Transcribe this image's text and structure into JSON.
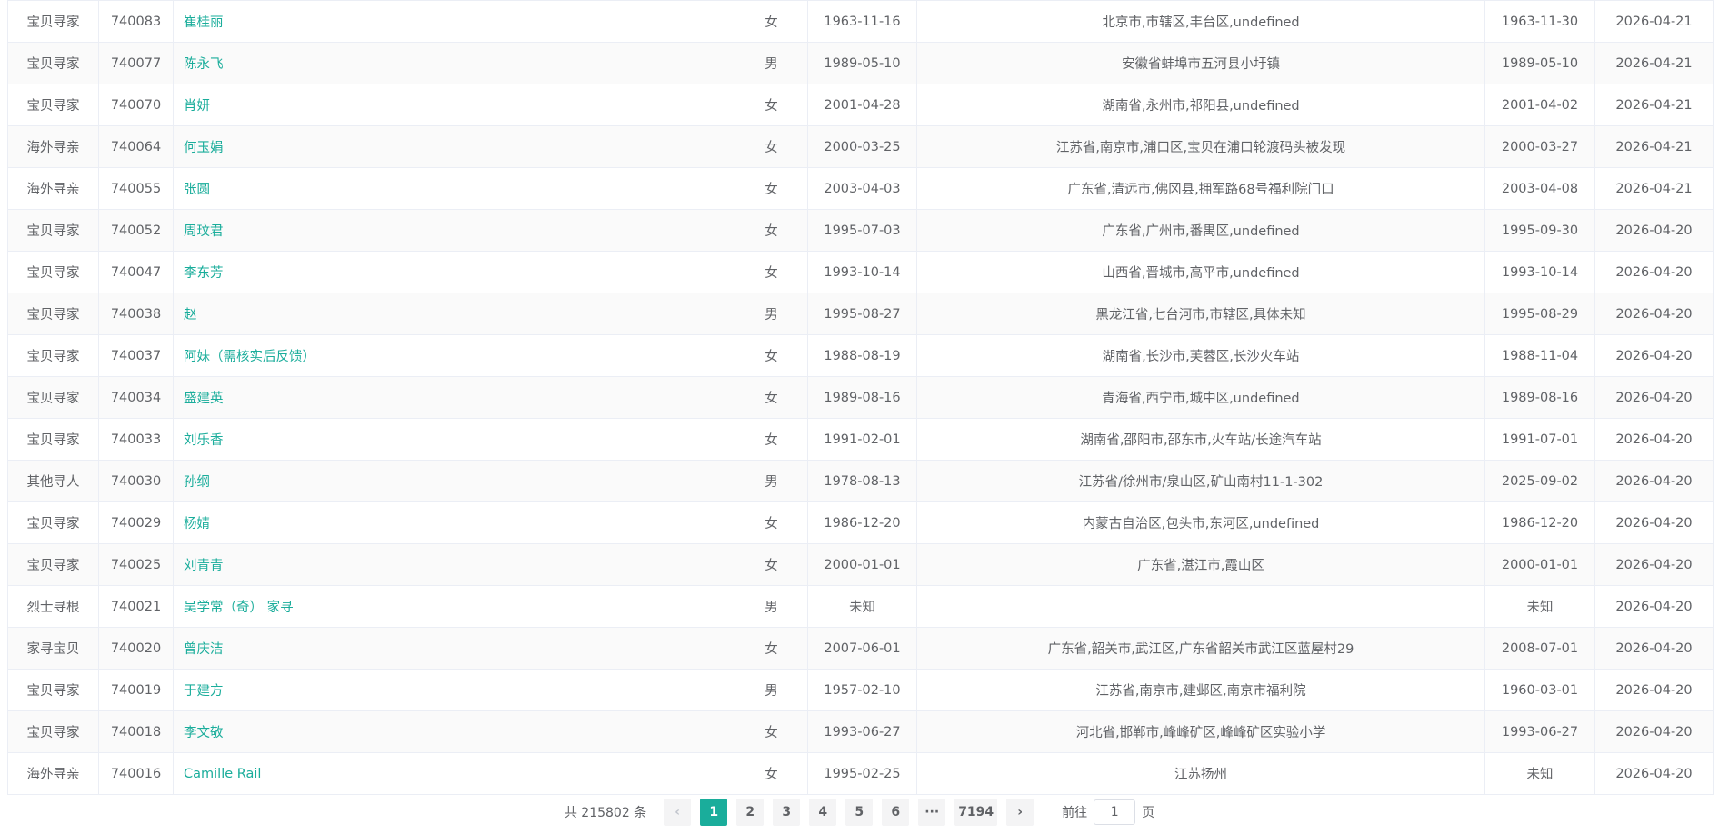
{
  "rows": [
    {
      "category": "宝贝寻家",
      "id": "740083",
      "name": "崔桂丽",
      "gender": "女",
      "birth": "1963-11-16",
      "place": "北京市,市辖区,丰台区,undefined",
      "lost": "1963-11-30",
      "posted": "2026-04-21"
    },
    {
      "category": "宝贝寻家",
      "id": "740077",
      "name": "陈永飞",
      "gender": "男",
      "birth": "1989-05-10",
      "place": "安徽省蚌埠市五河县小圩镇",
      "lost": "1989-05-10",
      "posted": "2026-04-21"
    },
    {
      "category": "宝贝寻家",
      "id": "740070",
      "name": "肖妍",
      "gender": "女",
      "birth": "2001-04-28",
      "place": "湖南省,永州市,祁阳县,undefined",
      "lost": "2001-04-02",
      "posted": "2026-04-21"
    },
    {
      "category": "海外寻亲",
      "id": "740064",
      "name": "何玉娟",
      "gender": "女",
      "birth": "2000-03-25",
      "place": "江苏省,南京市,浦口区,宝贝在浦口轮渡码头被发现",
      "lost": "2000-03-27",
      "posted": "2026-04-21"
    },
    {
      "category": "海外寻亲",
      "id": "740055",
      "name": "张圆",
      "gender": "女",
      "birth": "2003-04-03",
      "place": "广东省,清远市,佛冈县,拥军路68号福利院门口",
      "lost": "2003-04-08",
      "posted": "2026-04-21"
    },
    {
      "category": "宝贝寻家",
      "id": "740052",
      "name": "周玟君",
      "gender": "女",
      "birth": "1995-07-03",
      "place": "广东省,广州市,番禺区,undefined",
      "lost": "1995-09-30",
      "posted": "2026-04-20"
    },
    {
      "category": "宝贝寻家",
      "id": "740047",
      "name": "李东芳",
      "gender": "女",
      "birth": "1993-10-14",
      "place": "山西省,晋城市,高平市,undefined",
      "lost": "1993-10-14",
      "posted": "2026-04-20"
    },
    {
      "category": "宝贝寻家",
      "id": "740038",
      "name": "赵",
      "gender": "男",
      "birth": "1995-08-27",
      "place": "黑龙江省,七台河市,市辖区,具体未知",
      "lost": "1995-08-29",
      "posted": "2026-04-20"
    },
    {
      "category": "宝贝寻家",
      "id": "740037",
      "name": "阿妹（需核实后反馈）",
      "gender": "女",
      "birth": "1988-08-19",
      "place": "湖南省,长沙市,芙蓉区,长沙火车站",
      "lost": "1988-11-04",
      "posted": "2026-04-20"
    },
    {
      "category": "宝贝寻家",
      "id": "740034",
      "name": "盛建英",
      "gender": "女",
      "birth": "1989-08-16",
      "place": "青海省,西宁市,城中区,undefined",
      "lost": "1989-08-16",
      "posted": "2026-04-20"
    },
    {
      "category": "宝贝寻家",
      "id": "740033",
      "name": "刘乐香",
      "gender": "女",
      "birth": "1991-02-01",
      "place": "湖南省,邵阳市,邵东市,火车站/长途汽车站",
      "lost": "1991-07-01",
      "posted": "2026-04-20"
    },
    {
      "category": "其他寻人",
      "id": "740030",
      "name": "孙纲",
      "gender": "男",
      "birth": "1978-08-13",
      "place": "江苏省/徐州市/泉山区,矿山南村11-1-302",
      "lost": "2025-09-02",
      "posted": "2026-04-20"
    },
    {
      "category": "宝贝寻家",
      "id": "740029",
      "name": "杨婧",
      "gender": "女",
      "birth": "1986-12-20",
      "place": "内蒙古自治区,包头市,东河区,undefined",
      "lost": "1986-12-20",
      "posted": "2026-04-20"
    },
    {
      "category": "宝贝寻家",
      "id": "740025",
      "name": "刘青青",
      "gender": "女",
      "birth": "2000-01-01",
      "place": "广东省,湛江市,霞山区",
      "lost": "2000-01-01",
      "posted": "2026-04-20"
    },
    {
      "category": "烈士寻根",
      "id": "740021",
      "name": "吴学常（奇） 家寻",
      "gender": "男",
      "birth": "未知",
      "place": "",
      "lost": "未知",
      "posted": "2026-04-20"
    },
    {
      "category": "家寻宝贝",
      "id": "740020",
      "name": "曾庆洁",
      "gender": "女",
      "birth": "2007-06-01",
      "place": "广东省,韶关市,武江区,广东省韶关市武江区蓝屋村29",
      "lost": "2008-07-01",
      "posted": "2026-04-20"
    },
    {
      "category": "宝贝寻家",
      "id": "740019",
      "name": "于建方",
      "gender": "男",
      "birth": "1957-02-10",
      "place": "江苏省,南京市,建邺区,南京市福利院",
      "lost": "1960-03-01",
      "posted": "2026-04-20"
    },
    {
      "category": "宝贝寻家",
      "id": "740018",
      "name": "李文敬",
      "gender": "女",
      "birth": "1993-06-27",
      "place": "河北省,邯郸市,峰峰矿区,峰峰矿区实验小学",
      "lost": "1993-06-27",
      "posted": "2026-04-20"
    },
    {
      "category": "海外寻亲",
      "id": "740016",
      "name": "Camille Rail",
      "gender": "女",
      "birth": "1995-02-25",
      "place": "江苏扬州",
      "lost": "未知",
      "posted": "2026-04-20"
    }
  ],
  "pagination": {
    "total_text": "共 215802 条",
    "prev_icon": "‹",
    "next_icon": "›",
    "pages": [
      "1",
      "2",
      "3",
      "4",
      "5",
      "6"
    ],
    "current": "1",
    "ellipsis": "···",
    "last_page": "7194",
    "goto_prefix": "前往",
    "goto_value": "1",
    "goto_suffix": "页"
  },
  "colors": {
    "accent": "#1aad9b",
    "border": "#ebeef5",
    "stripe": "#fafafa",
    "text": "#606266"
  }
}
